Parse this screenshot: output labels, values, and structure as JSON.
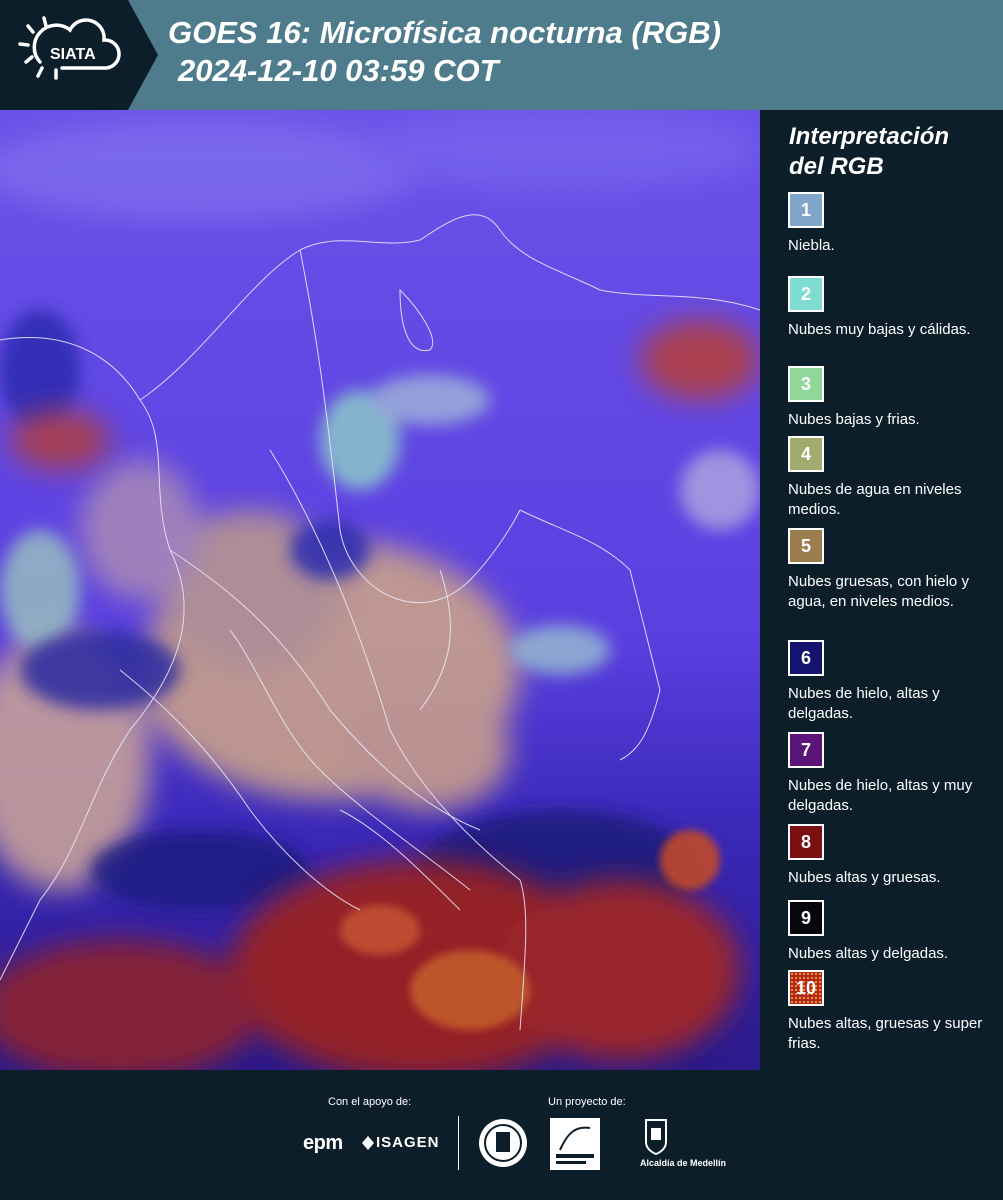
{
  "header": {
    "logo_text": "SIATA",
    "title_line1": "GOES 16: Microfísica nocturna (RGB)",
    "title_line2": "2024-12-10 03:59 COT"
  },
  "legend": {
    "title_line1": "Interpretación",
    "title_line2": "del RGB",
    "items": [
      {
        "number": "1",
        "label": "Niebla.",
        "color": "#7fa6c8"
      },
      {
        "number": "2",
        "label": "Nubes muy bajas y cálidas.",
        "color": "#7fdcd3"
      },
      {
        "number": "3",
        "label": "Nubes bajas y frias.",
        "color": "#8fd89a"
      },
      {
        "number": "4",
        "label": "Nubes de agua en niveles medios.",
        "color": "#a3aa6e"
      },
      {
        "number": "5",
        "label": "Nubes gruesas, con hielo y agua, en niveles medios.",
        "color": "#9c7d4e"
      },
      {
        "number": "6",
        "label": "Nubes de hielo, altas y delgadas.",
        "color": "#14146e"
      },
      {
        "number": "7",
        "label": "Nubes de hielo, altas y muy delgadas.",
        "color": "#5b1478"
      },
      {
        "number": "8",
        "label": "Nubes altas y gruesas.",
        "color": "#7a1010"
      },
      {
        "number": "9",
        "label": "Nubes altas y delgadas.",
        "color": "#06060c"
      },
      {
        "number": "10",
        "label": "Nubes altas, gruesas y super frias.",
        "color": "#b3261e"
      }
    ]
  },
  "footer": {
    "support_label": "Con el apoyo de:",
    "project_label": "Un proyecto de:",
    "epm": "epm",
    "isagen": "ISAGEN",
    "alcaldia": "Alcaldía de Medellín"
  }
}
